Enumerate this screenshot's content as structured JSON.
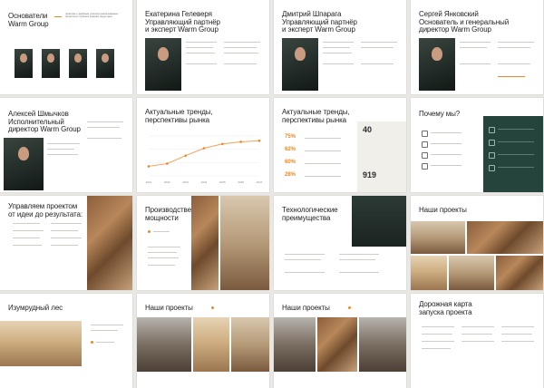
{
  "slides": [
    {
      "title": "Основатели",
      "title2": "Warm Group",
      "tagline": "практике с двойным успехом реализованных проектов в глубоких знаниях индустрии"
    },
    {
      "title": "Екатерина Гелеверя",
      "title2": "Управляющий партнёр",
      "title3": "и эксперт Warm Group"
    },
    {
      "title": "Дмитрий Шпарага",
      "title2": "Управляющий партнёр",
      "title3": "и эксперт Warm Group"
    },
    {
      "title": "Сергей Янковский",
      "title2": "Основатель и генеральный",
      "title3": "директор Warm Group"
    },
    {
      "title": "Алексей Шмычков",
      "title2": "Исполнительный",
      "title3": "директор Warm Group"
    },
    {
      "title": "Актуальные тренды,",
      "title2": "перспективы рынка"
    },
    {
      "title": "Актуальные тренды,",
      "title2": "перспективы рынка",
      "stats": [
        "75%",
        "62%",
        "60%",
        "28%"
      ],
      "big": [
        "40",
        "919"
      ]
    },
    {
      "title": "Почему мы?"
    },
    {
      "title": "Управляем проектом",
      "title2": "от идеи до результата:"
    },
    {
      "title": "Производственные",
      "title2": "мощности"
    },
    {
      "title": "Технологические",
      "title2": "преимущества"
    },
    {
      "title": "Наши проекты"
    },
    {
      "title": "Изумрудный лес"
    },
    {
      "title": "Наши проекты"
    },
    {
      "title": "Наши проекты"
    },
    {
      "title": "Дорожная карта",
      "title2": "запуска проекта"
    }
  ],
  "chart_data": {
    "type": "line",
    "title": "",
    "x": [
      "2021",
      "2022",
      "2023",
      "2024",
      "2025",
      "2026",
      "2027"
    ],
    "series": [
      {
        "values": [
          18,
          23,
          38,
          52,
          60,
          64,
          66
        ]
      }
    ],
    "ylim": [
      0,
      75
    ],
    "grid": true
  }
}
